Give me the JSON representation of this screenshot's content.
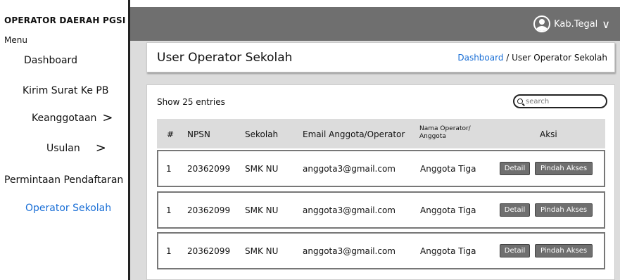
{
  "sidebar": {
    "brand": "OPERATOR DAERAH PGSI",
    "menu_title": "Menu",
    "items": [
      {
        "label": "Dashboard"
      },
      {
        "label": "Kirim Surat Ke PB"
      },
      {
        "label": "Keanggotaan",
        "chevron": ">"
      },
      {
        "label": "Usulan",
        "chevron": ">"
      },
      {
        "label": "Permintaan Pendaftaran"
      },
      {
        "label": "Operator Sekolah",
        "active": true
      }
    ]
  },
  "header": {
    "user": "Kab.Tegal"
  },
  "page": {
    "title": "User Operator Sekolah",
    "breadcrumb_link": "Dashboard",
    "breadcrumb_current": " / User Operator Sekolah"
  },
  "table": {
    "entries_label": "Show 25 entries",
    "search_placeholder": "search",
    "headers": [
      "#",
      "NPSN",
      "Sekolah",
      "Email Anggota/Operator",
      "Nama Operator/ Anggota",
      "Aksi"
    ],
    "rows": [
      {
        "no": "1",
        "npsn": "20362099",
        "sekolah": "SMK NU",
        "email": "anggota3@gmail.com",
        "nama": "Anggota Tiga",
        "detail": "Detail",
        "pindah": "Pindah Akses"
      },
      {
        "no": "1",
        "npsn": "20362099",
        "sekolah": "SMK NU",
        "email": "anggota3@gmail.com",
        "nama": "Anggota Tiga",
        "detail": "Detail",
        "pindah": "Pindah Akses"
      },
      {
        "no": "1",
        "npsn": "20362099",
        "sekolah": "SMK NU",
        "email": "anggota3@gmail.com",
        "nama": "Anggota Tiga",
        "detail": "Detail",
        "pindah": "Pindah Akses"
      }
    ]
  },
  "colors": {
    "header_bg": "#6f6f6f",
    "content_bg": "#dcdcdc",
    "accent": "#1a6fd6"
  }
}
